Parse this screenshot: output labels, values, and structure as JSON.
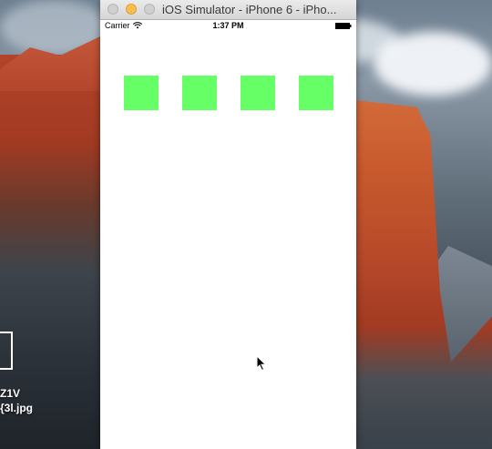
{
  "desktop": {
    "file_labels": [
      "Z1V",
      "{3l.jpg"
    ]
  },
  "simulator": {
    "window_title": "iOS Simulator - iPhone 6 - iPho...",
    "status_bar": {
      "carrier": "Carrier",
      "time": "1:37 PM"
    },
    "squares": {
      "count": 4,
      "color": "#66ff66"
    }
  },
  "colors": {
    "titlebar": "#d6d5d6",
    "minimize_light": "#f5be4f",
    "screen_background": "#ffffff"
  },
  "icons": [
    "wifi-icon",
    "battery-icon",
    "mouse-cursor-icon"
  ]
}
